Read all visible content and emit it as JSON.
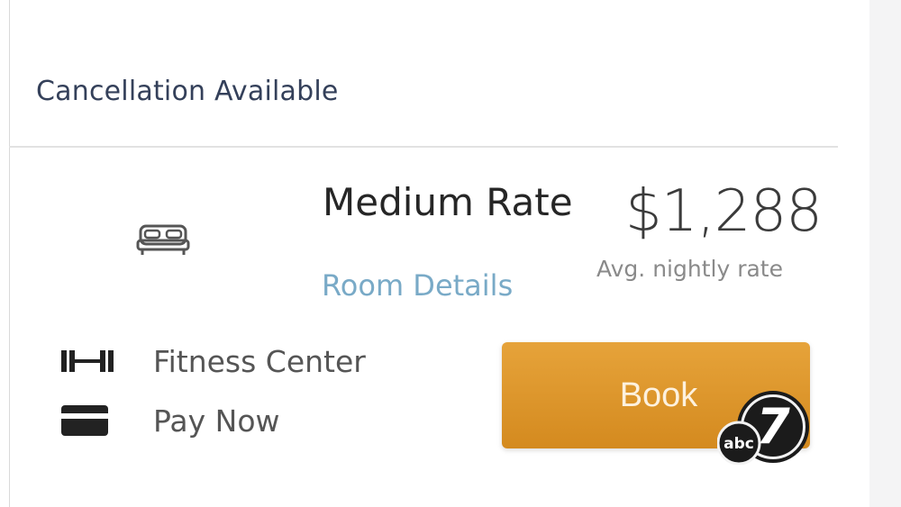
{
  "cancellation": {
    "label": "Cancellation Available"
  },
  "rate": {
    "name": "Medium Rate",
    "price": "$1,288",
    "price_caption": "Avg. nightly rate",
    "room_details_link": "Room Details",
    "book_label": "Book"
  },
  "amenities": [
    {
      "icon": "dumbbell-icon",
      "label": "Fitness Center"
    },
    {
      "icon": "credit-card-icon",
      "label": "Pay Now"
    }
  ],
  "logo": {
    "text": "abc",
    "number": "7"
  },
  "colors": {
    "book_button": "#e09a2e",
    "link": "#79aac7",
    "heading": "#34405a"
  }
}
